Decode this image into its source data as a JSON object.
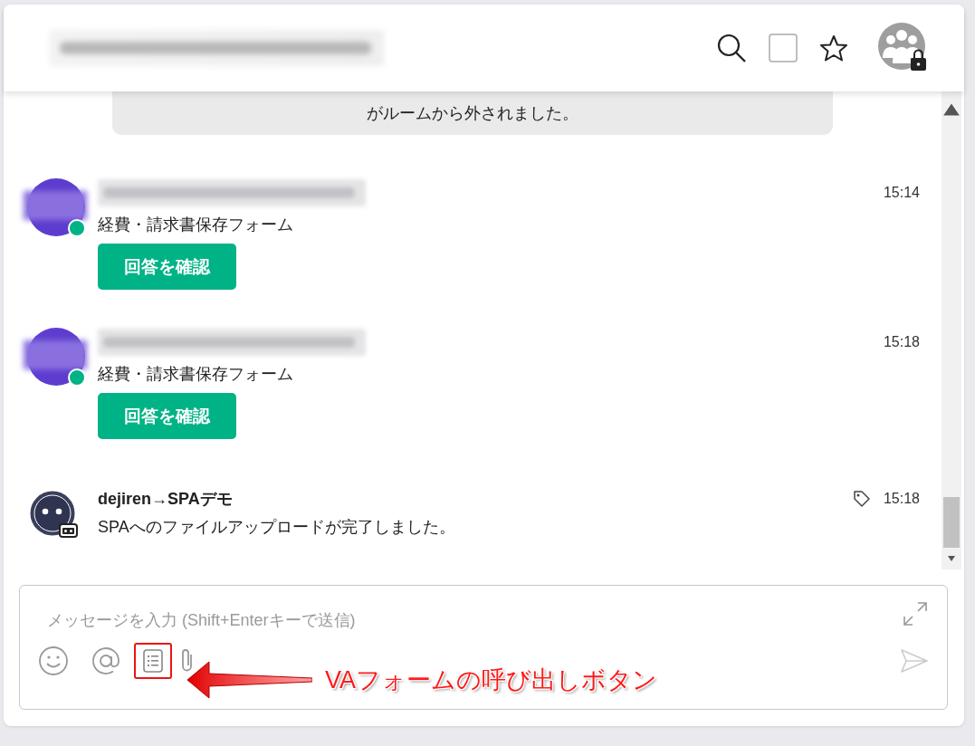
{
  "messages": [
    {
      "kind": "system",
      "text": "がルームから外されました。"
    },
    {
      "kind": "user",
      "online": true,
      "text": "経費・請求書保存フォーム",
      "time": "15:14",
      "button": "回答を確認"
    },
    {
      "kind": "user",
      "online": true,
      "text": "経費・請求書保存フォーム",
      "time": "15:18",
      "button": "回答を確認"
    },
    {
      "kind": "bot",
      "sender": "dejiren→SPAデモ",
      "text": "SPAへのファイルアップロードが完了しました。",
      "time": "15:18",
      "tagged": true
    }
  ],
  "composer": {
    "placeholder": "メッセージを入力 (Shift+Enterキーで送信)",
    "tools": [
      {
        "kind": "emoji",
        "highlighted": false
      },
      {
        "kind": "mention",
        "highlighted": false
      },
      {
        "kind": "form",
        "highlighted": true
      },
      {
        "kind": "attachment",
        "highlighted": false
      }
    ]
  },
  "annotation": {
    "text": "VAフォームの呼び出しボタン"
  }
}
